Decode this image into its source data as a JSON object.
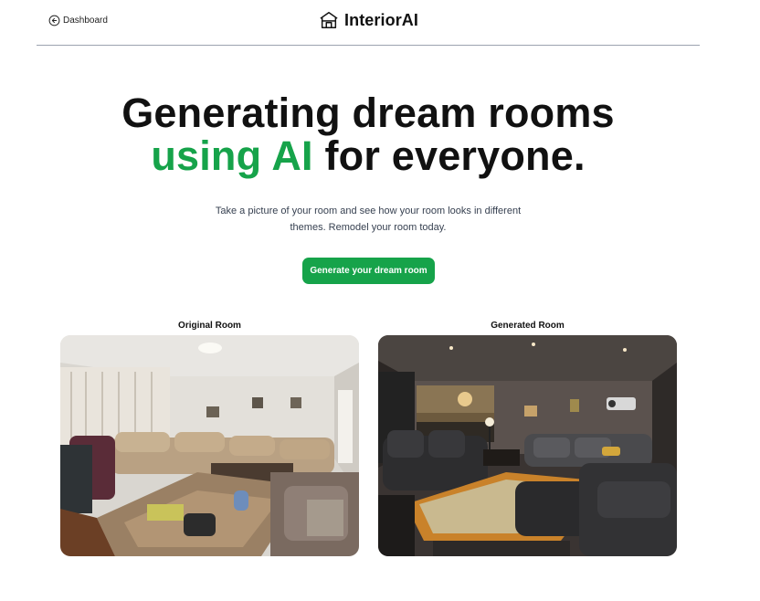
{
  "header": {
    "back_label": "Dashboard",
    "logo_text": "InteriorAI"
  },
  "hero": {
    "title_line1": "Generating dream rooms",
    "title_accent": "using AI",
    "title_line2_rest": " for everyone.",
    "subtitle": "Take a picture of your room and see how your room looks in different themes. Remodel your room today.",
    "cta_label": "Generate your dream room"
  },
  "comparison": {
    "original_label": "Original Room",
    "generated_label": "Generated Room"
  },
  "colors": {
    "accent": "#16a34a",
    "divider": "#9ca3af"
  }
}
